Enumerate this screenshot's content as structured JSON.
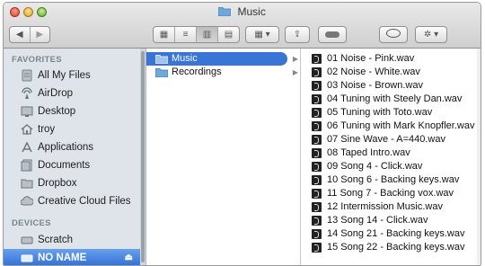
{
  "window": {
    "title": "Music"
  },
  "toolbar": {
    "back_icon": "chevron-left-icon",
    "forward_icon": "chevron-right-icon",
    "view_modes": [
      "icon-view-icon",
      "list-view-icon",
      "column-view-icon",
      "coverflow-view-icon"
    ],
    "active_view": "column",
    "arrange_icon": "arrange-icon",
    "share_icon": "share-icon",
    "tags_icon": "tag-icon",
    "quicklook_icon": "eye-icon",
    "action_icon": "gear-icon"
  },
  "sidebar": {
    "favorites_header": "FAVORITES",
    "favorites": [
      {
        "label": "All My Files",
        "icon": "all-files-icon"
      },
      {
        "label": "AirDrop",
        "icon": "airdrop-icon"
      },
      {
        "label": "Desktop",
        "icon": "desktop-icon"
      },
      {
        "label": "troy",
        "icon": "home-icon"
      },
      {
        "label": "Applications",
        "icon": "applications-icon"
      },
      {
        "label": "Documents",
        "icon": "documents-icon"
      },
      {
        "label": "Dropbox",
        "icon": "dropbox-icon"
      },
      {
        "label": "Creative Cloud Files",
        "icon": "creative-cloud-icon"
      }
    ],
    "devices_header": "DEVICES",
    "devices": [
      {
        "label": "Scratch",
        "icon": "drive-icon"
      },
      {
        "label": "NO NAME",
        "icon": "drive-icon",
        "selected": true
      }
    ]
  },
  "column1": {
    "items": [
      {
        "label": "Music",
        "selected": true
      },
      {
        "label": "Recordings",
        "selected": false
      }
    ]
  },
  "column2": {
    "files": [
      "01 Noise - Pink.wav",
      "02 Noise - White.wav",
      "03 Noise - Brown.wav",
      "04 Tuning with Steely Dan.wav",
      "05 Tuning with Toto.wav",
      "06 Tuning with Mark Knopfler.wav",
      "07 Sine Wave - A=440.wav",
      "08 Taped Intro.wav",
      "09 Song 4 - Click.wav",
      "10 Song 6 - Backing keys.wav",
      "11 Song 7 - Backing vox.wav",
      "12 Intermission Music.wav",
      "13 Song 14 - Click.wav",
      "14 Song 21 - Backing keys.wav",
      "15 Song 22 - Backing keys.wav"
    ]
  },
  "colors": {
    "selection": "#3875d7",
    "sidebar_bg": "#dfe4ea"
  }
}
